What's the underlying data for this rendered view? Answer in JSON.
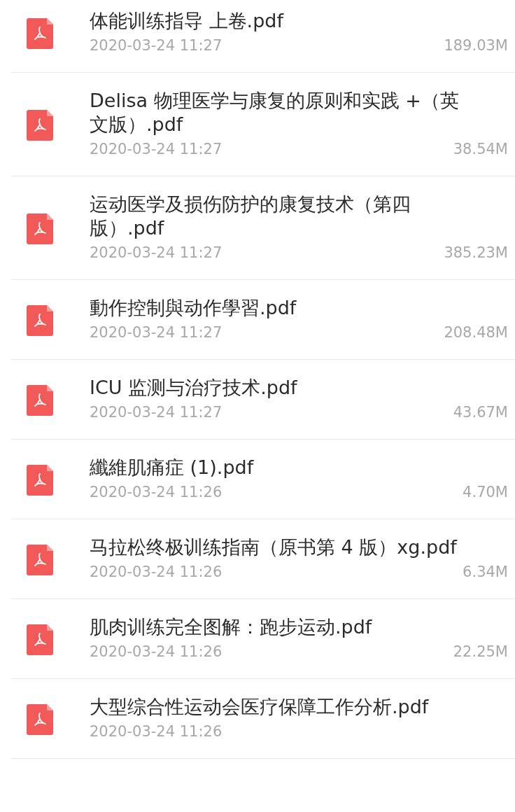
{
  "files": [
    {
      "name": "体能训练指导 上卷.pdf",
      "date": "2020-03-24 11:27",
      "size": "189.03M"
    },
    {
      "name": "Delisa 物理医学与康复的原则和实践 +（英文版）.pdf",
      "date": "2020-03-24 11:27",
      "size": "38.54M"
    },
    {
      "name": "运动医学及损伤防护的康复技术（第四版）.pdf",
      "date": "2020-03-24 11:27",
      "size": "385.23M"
    },
    {
      "name": "動作控制與动作學習.pdf",
      "date": "2020-03-24 11:27",
      "size": "208.48M"
    },
    {
      "name": "ICU 监测与治疗技术.pdf",
      "date": "2020-03-24 11:27",
      "size": "43.67M"
    },
    {
      "name": "纖維肌痛症 (1).pdf",
      "date": "2020-03-24 11:26",
      "size": "4.70M"
    },
    {
      "name": "马拉松终极训练指南（原书第 4 版）xg.pdf",
      "date": "2020-03-24 11:26",
      "size": "6.34M"
    },
    {
      "name": "肌肉训练完全图解：跑步运动.pdf",
      "date": "2020-03-24 11:26",
      "size": "22.25M"
    },
    {
      "name": "大型综合性运动会医疗保障工作分析.pdf",
      "date": "2020-03-24 11:26"
    }
  ]
}
